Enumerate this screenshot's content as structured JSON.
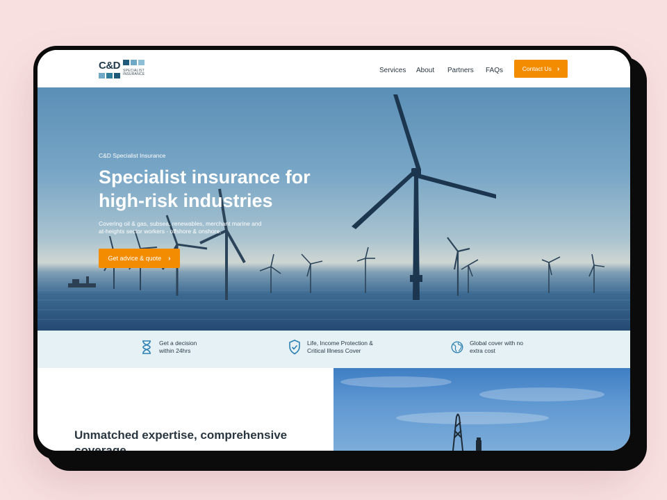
{
  "brand": {
    "logo_text": "C&D",
    "logo_subtext_line1": "SPECIALIST",
    "logo_subtext_line2": "INSURANCE",
    "colors": {
      "navy": "#1f5a7a",
      "teal": "#2f7f9a",
      "light": "#8fbfd6",
      "accent": "#f38c00"
    }
  },
  "nav": {
    "items": [
      {
        "label": "Services"
      },
      {
        "label": "About"
      },
      {
        "label": "Partners"
      },
      {
        "label": "FAQs"
      }
    ],
    "contact_label": "Contact Us",
    "contact_icon": "chevron-right-icon"
  },
  "hero": {
    "eyebrow": "C&D Specialist Insurance",
    "title_line1": "Specialist insurance for",
    "title_line2": "high-risk industries",
    "desc_line1": "Covering oil & gas, subsea, renewables, merchant marine and",
    "desc_line2": "at-heights sector workers - offshore & onshore.",
    "cta_label": "Get advice & quote",
    "cta_icon": "chevron-right-icon",
    "image": "offshore-wind-farm"
  },
  "features": [
    {
      "icon": "hourglass-icon",
      "line1": "Get a decision",
      "line2": "within 24hrs"
    },
    {
      "icon": "shield-check-icon",
      "line1": "Life, Income Protection &",
      "line2": "Critical Illness Cover"
    },
    {
      "icon": "globe-icon",
      "line1": "Global cover with no",
      "line2": "extra cost"
    }
  ],
  "section": {
    "title_line1": "Unmatched expertise, comprehensive",
    "title_line2": "coverage",
    "image": "offshore-rig-sky"
  }
}
